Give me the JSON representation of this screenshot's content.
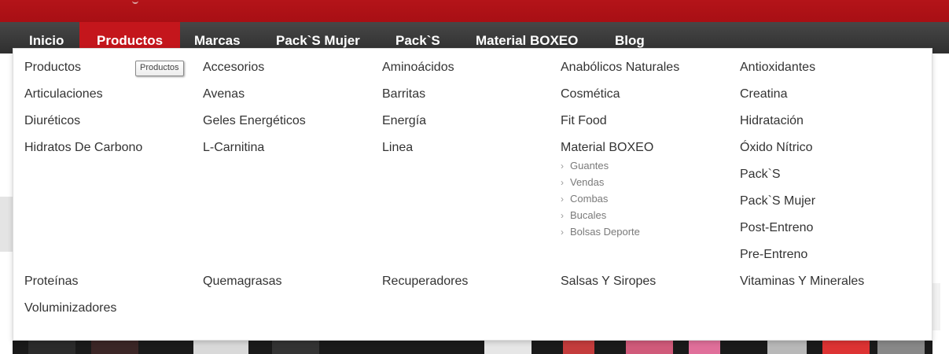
{
  "nav": {
    "items": [
      {
        "label": "Inicio"
      },
      {
        "label": "Productos",
        "active": true
      },
      {
        "label": "Marcas"
      },
      {
        "label": "Pack`S Mujer"
      },
      {
        "label": "Pack`S"
      },
      {
        "label": "Material BOXEO"
      },
      {
        "label": "Blog"
      }
    ]
  },
  "menu": {
    "row1": {
      "col1": [
        "Productos",
        "Articulaciones",
        "Diuréticos",
        "Hidratos De Carbono"
      ],
      "col2": [
        "Accesorios",
        "Avenas",
        "Geles Energéticos",
        "L-Carnitina"
      ],
      "col3": [
        "Aminoácidos",
        "Barritas",
        "Energía",
        "Linea"
      ],
      "col4": [
        "Anabólicos Naturales",
        "Cosmética",
        "Fit Food",
        "Material BOXEO"
      ],
      "col4_sub": [
        "Guantes",
        "Vendas",
        "Combas",
        "Bucales",
        "Bolsas Deporte"
      ],
      "col5": [
        "Antioxidantes",
        "Creatina",
        "Hidratación",
        "Óxido Nítrico",
        "Pack`S",
        "Pack`S Mujer",
        "Post-Entreno",
        "Pre-Entreno"
      ]
    },
    "row2": [
      "Proteínas",
      "Quemagrasas",
      "Recuperadores",
      "Salsas Y Siropes",
      "Vitaminas Y Minerales"
    ],
    "row3": [
      "Voluminizadores"
    ]
  },
  "tooltip": {
    "text": "Productos"
  },
  "colors": {
    "brand_red": "#c4161c",
    "nav_dark": "#3a3a3a",
    "text": "#333333"
  }
}
